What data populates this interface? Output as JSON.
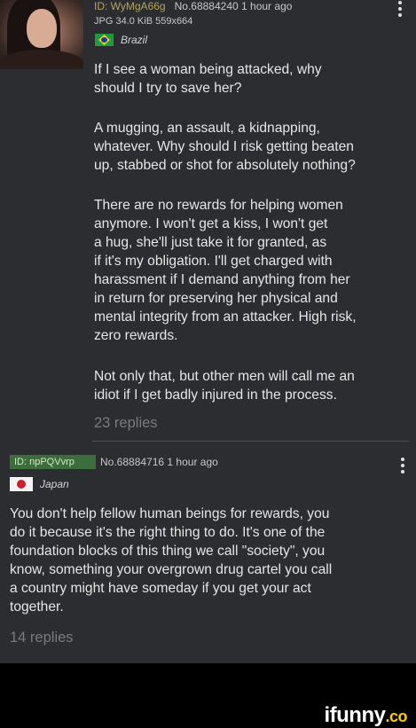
{
  "post1": {
    "id_label": "ID: WyMgA66g",
    "post_number": "No.68884240",
    "time": "1 hour ago",
    "file_info": "JPG 34.0 KiB 559x664",
    "country": "Brazil",
    "paragraphs": [
      "If I see a woman being attacked, why\nshould I try to save her?",
      "A mugging, an assault, a kidnapping,\nwhatever. Why should I risk getting beaten\nup, stabbed or shot for absolutely nothing?",
      "There are no rewards for helping women\nanymore. I won't get a kiss, I won't get\na hug, she'll just take it for granted, as\nif it's my obligation. I'll get charged with\nharassment if I demand anything from her\nin return for preserving her physical and\nmental integrity from an attacker. High risk,\nzero rewards.",
      "Not only that, but other men will call me an\nidiot if I get badly injured in the process."
    ],
    "replies": "23 replies"
  },
  "post2": {
    "id_label": "ID: npPQVvrp",
    "post_number": "No.68884716",
    "time": "1 hour ago",
    "country": "Japan",
    "text": "You don't help fellow human beings for rewards, you\ndo it because it's the right thing to do. It's one of the\nfoundation blocks of this thing we call \"society\", you\nknow, something your overgrown drug cartel you call\na country might have someday if you get your act\ntogether.",
    "replies": "14 replies"
  },
  "watermark": {
    "text": "ifunny",
    "suffix": ".co"
  },
  "colors": {
    "background": "#2b2d31",
    "id_badge": "#3c6e3c",
    "text": "#e6e6e6",
    "muted": "#777a80"
  }
}
